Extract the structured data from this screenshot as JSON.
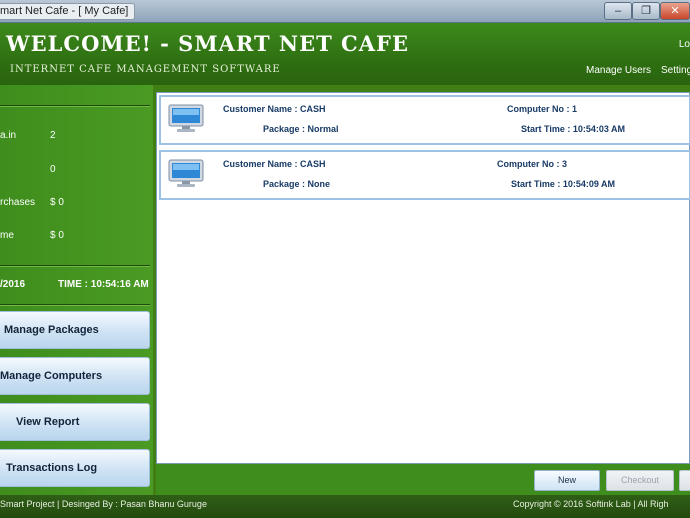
{
  "window": {
    "title": "mart Net Cafe - [ My Cafe]",
    "min_label": "–",
    "max_label": "❐",
    "close_label": "✕"
  },
  "header": {
    "welcome": "WELCOME! - SMART NET CAFE",
    "subtitle": "INTERNET CAFE MANAGEMENT SOFTWARE",
    "user_label": "Lo",
    "manage_users": "Manage Users",
    "settings": "Setting"
  },
  "stats": [
    {
      "label": "a.in",
      "value": "2"
    },
    {
      "label": "",
      "value": "0"
    },
    {
      "label": "rchases",
      "value": "$ 0"
    },
    {
      "label": "me",
      "value": "$ 0"
    }
  ],
  "datetime": {
    "date": "/2016",
    "time": "TIME : 10:54:16 AM"
  },
  "nav": [
    {
      "label": "Manage Packages"
    },
    {
      "label": "Manage Computers"
    },
    {
      "label": "View Report"
    },
    {
      "label": "Transactions Log"
    }
  ],
  "sessions": [
    {
      "customer": "Customer Name : CASH",
      "package": "Package : Normal",
      "computer": "Computer No : 1",
      "start": "Start Time : 10:54:03 AM"
    },
    {
      "customer": "Customer Name : CASH",
      "package": "Package : None",
      "computer": "Computer No : 3",
      "start": "Start Time : 10:54:09 AM"
    }
  ],
  "actions": {
    "new": "New",
    "checkout": "Checkout"
  },
  "footer": {
    "left": "Smart Project | Desinged By : Pasan Bhanu Guruge",
    "right": "Copyright © 2016 Softink Lab | All Righ"
  }
}
